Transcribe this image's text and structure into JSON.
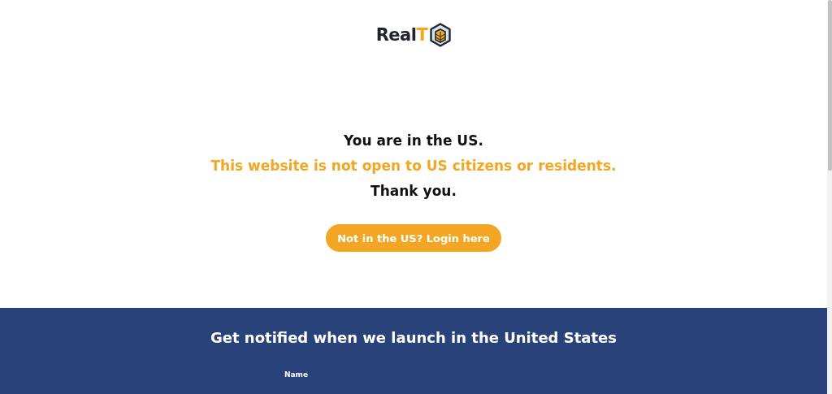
{
  "logo": {
    "text": "Real",
    "accent": "T"
  },
  "message": {
    "line_1": "You are in the US.",
    "line_2": "This website is not open to US citizens or residents.",
    "line_3": "Thank you."
  },
  "login_button": "Not in the US? Login here",
  "signup": {
    "title": "Get notified when we launch in the United States",
    "fields": [
      {
        "label": "Name"
      }
    ]
  }
}
